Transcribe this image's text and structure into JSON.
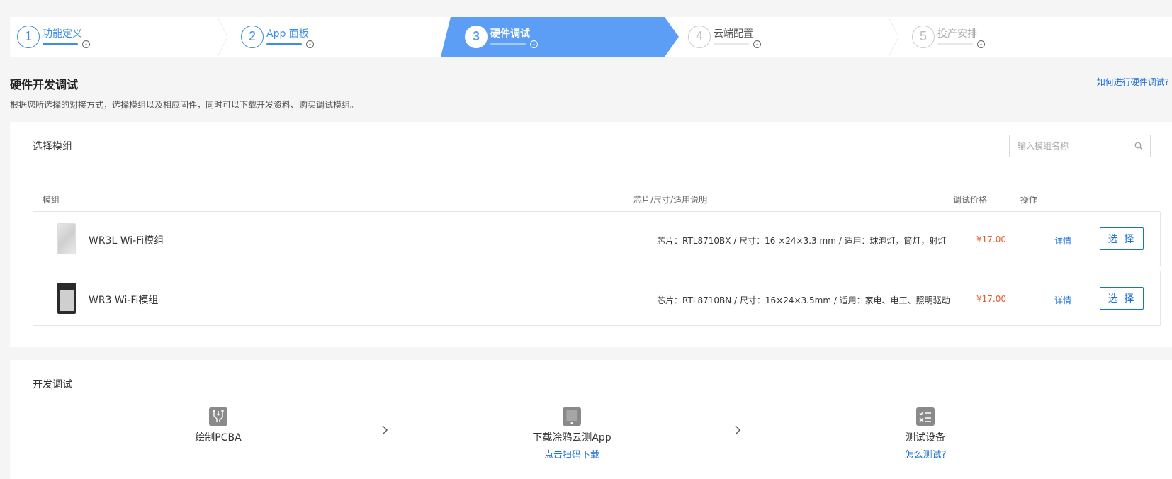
{
  "stepper": {
    "steps": [
      {
        "num": "1",
        "label": "功能定义"
      },
      {
        "num": "2",
        "label": "App 面板"
      },
      {
        "num": "3",
        "label": "硬件调试"
      },
      {
        "num": "4",
        "label": "云端配置"
      },
      {
        "num": "5",
        "label": "投产安排"
      }
    ],
    "active_index": 3
  },
  "header": {
    "title": "硬件开发调试",
    "help_link": "如何进行硬件调试?",
    "description": "根据您所选择的对接方式，选择模组以及相应固件，同时可以下载开发资料、购买调试模组。"
  },
  "module_section": {
    "title": "选择模组",
    "search_placeholder": "输入模组名称",
    "columns": [
      "模组",
      "芯片/尺寸/适用说明",
      "调试价格",
      "操作"
    ],
    "rows": [
      {
        "name": "WR3L Wi-Fi模组",
        "desc": "芯片：RTL8710BX / 尺寸：16 ×24×3.3 mm / 适用：球泡灯，筒灯，射灯",
        "price": "¥17.00",
        "detail": "详情",
        "action": "选 择"
      },
      {
        "name": "WR3 Wi-Fi模组",
        "desc": "芯片：RTL8710BN / 尺寸：16×24×3.5mm / 适用：家电、电工、照明驱动",
        "price": "¥17.00",
        "detail": "详情",
        "action": "选 择"
      }
    ]
  },
  "dev_section": {
    "title": "开发调试",
    "steps": [
      {
        "label": "绘制PCBA",
        "link": ""
      },
      {
        "label": "下载涂鸦云测App",
        "link": "点击扫码下载"
      },
      {
        "label": "测试设备",
        "link": "怎么测试?"
      }
    ]
  },
  "colors": {
    "accent": "#1a6fd6",
    "active_step_bg": "#5c9ef5",
    "price": "#e05a2b"
  }
}
